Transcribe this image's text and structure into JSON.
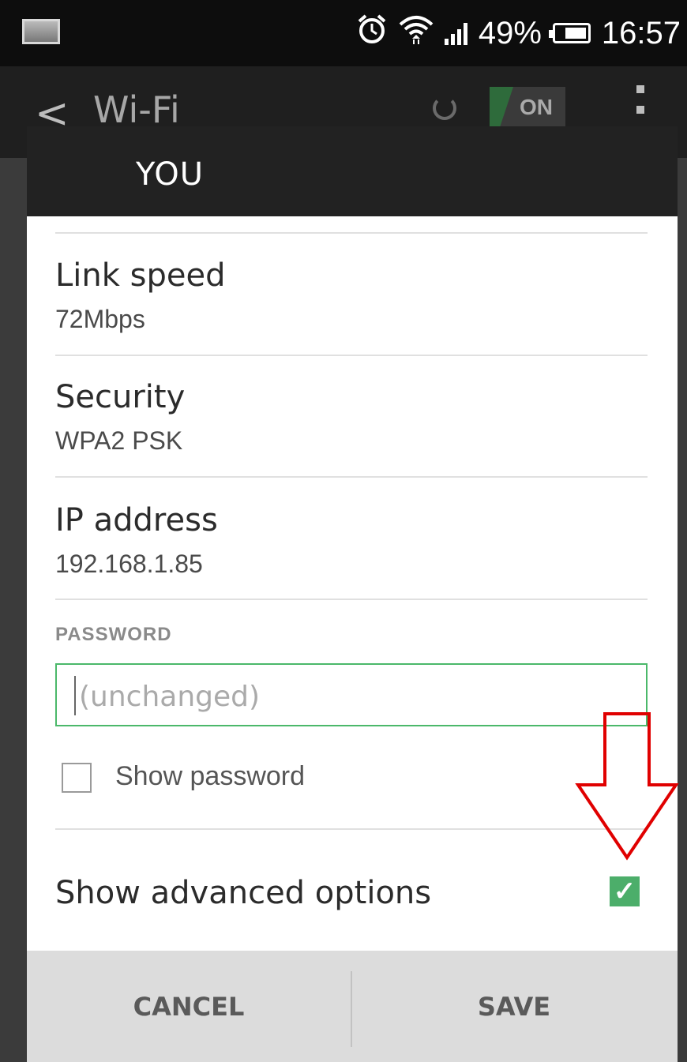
{
  "status_bar": {
    "battery": "49%",
    "time": "16:57"
  },
  "app_bar": {
    "title": "Wi-Fi",
    "toggle_label": "ON"
  },
  "dialog": {
    "title": "YOU",
    "rows": [
      {
        "label": "Link speed",
        "value": "72Mbps"
      },
      {
        "label": "Security",
        "value": "WPA2 PSK"
      },
      {
        "label": "IP address",
        "value": "192.168.1.85"
      }
    ],
    "password_section_label": "PASSWORD",
    "password_placeholder": "(unchanged)",
    "show_password_label": "Show password",
    "show_password_checked": false,
    "advanced_options_label": "Show advanced options",
    "advanced_options_checked": true,
    "cancel_label": "CANCEL",
    "save_label": "SAVE"
  },
  "colors": {
    "accent_green": "#4cae6a",
    "annotation_red": "#e00000"
  },
  "icons": [
    "screenshot-icon",
    "alarm-icon",
    "wifi-icon",
    "signal-icon",
    "battery-icon",
    "back-icon",
    "overflow-menu-icon",
    "arrow-annotation-icon"
  ]
}
